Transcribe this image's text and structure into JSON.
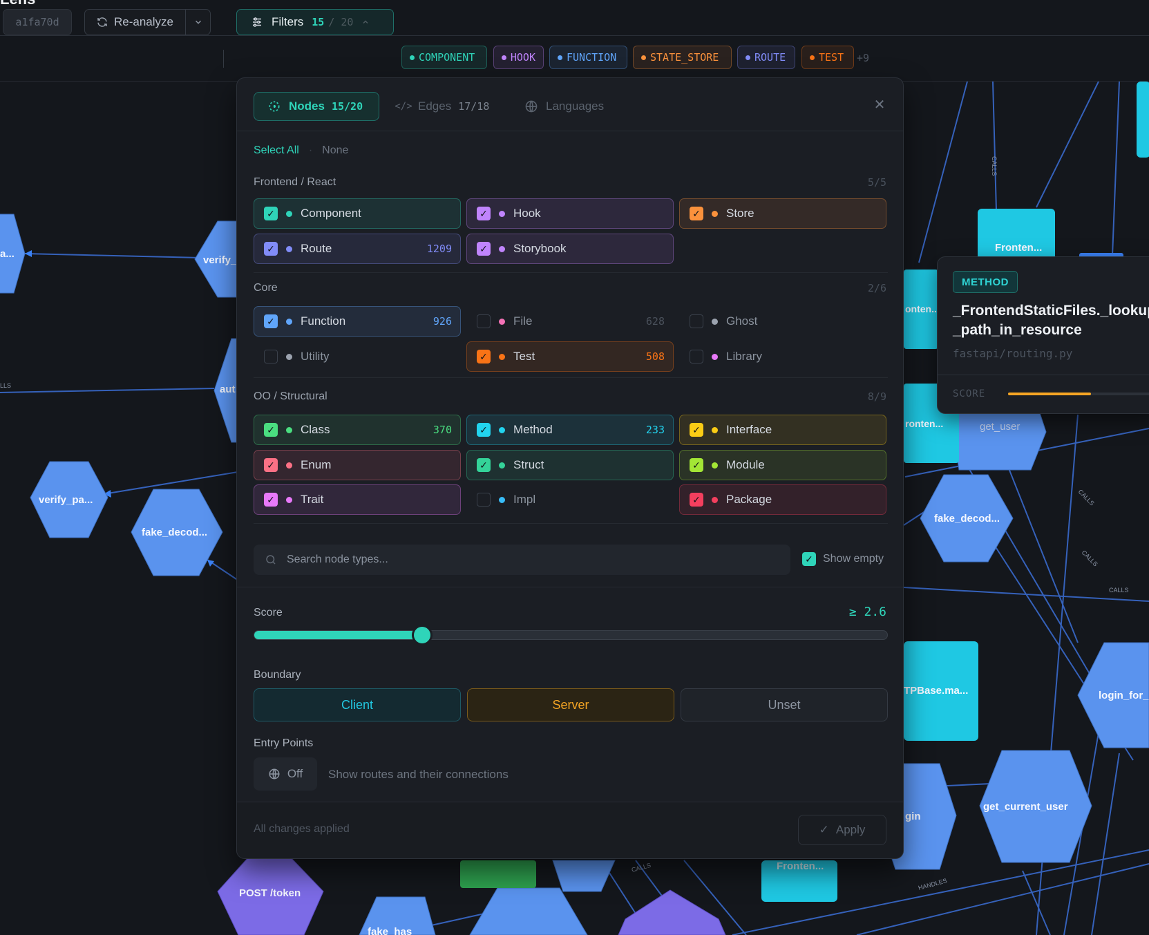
{
  "app": {
    "title": "Lens"
  },
  "toolbar": {
    "commit": "a1fa70d",
    "reanalyze_label": "Re-analyze",
    "filters_label": "Filters",
    "filters_active": "15",
    "filters_total": "/ 20",
    "chips": [
      {
        "label": "COMPONENT",
        "color": "#2fd4b9"
      },
      {
        "label": "HOOK",
        "color": "#c084fc"
      },
      {
        "label": "FUNCTION",
        "color": "#60a5fa"
      },
      {
        "label": "STATE_STORE",
        "color": "#fb923c"
      },
      {
        "label": "ROUTE",
        "color": "#818cf8"
      },
      {
        "label": "TEST",
        "color": "#f97316"
      }
    ],
    "chips_more": "+9"
  },
  "panel": {
    "tabs": {
      "nodes": {
        "label": "Nodes",
        "count": "15/20"
      },
      "edges": {
        "label": "Edges",
        "count": "17/18"
      },
      "languages": {
        "label": "Languages"
      }
    },
    "select_all": "Select All",
    "select_none": "None",
    "sections": [
      {
        "label": "Frontend / React",
        "count": "5/5"
      },
      {
        "label": "Core",
        "count": "2/6"
      },
      {
        "label": "OO / Structural",
        "count": "8/9"
      }
    ],
    "options": {
      "component": {
        "label": "Component",
        "count": "",
        "checked": true,
        "color": "#2fd4b9"
      },
      "hook": {
        "label": "Hook",
        "count": "",
        "checked": true,
        "color": "#c084fc"
      },
      "store": {
        "label": "Store",
        "count": "",
        "checked": true,
        "color": "#fb923c"
      },
      "route": {
        "label": "Route",
        "count": "1209",
        "checked": true,
        "color": "#818cf8"
      },
      "storybook": {
        "label": "Storybook",
        "count": "",
        "checked": true,
        "color": "#c084fc"
      },
      "function": {
        "label": "Function",
        "count": "926",
        "checked": true,
        "color": "#60a5fa"
      },
      "file": {
        "label": "File",
        "count": "628",
        "checked": false,
        "color": "#f472b6"
      },
      "ghost": {
        "label": "Ghost",
        "count": "",
        "checked": false,
        "color": "#9ca3af"
      },
      "utility": {
        "label": "Utility",
        "count": "",
        "checked": false,
        "color": "#9ca3af"
      },
      "test": {
        "label": "Test",
        "count": "508",
        "checked": true,
        "color": "#f97316"
      },
      "library": {
        "label": "Library",
        "count": "",
        "checked": false,
        "color": "#e879f9"
      },
      "class": {
        "label": "Class",
        "count": "370",
        "checked": true,
        "color": "#4ade80"
      },
      "method": {
        "label": "Method",
        "count": "233",
        "checked": true,
        "color": "#22d3ee"
      },
      "interface": {
        "label": "Interface",
        "count": "",
        "checked": true,
        "color": "#facc15"
      },
      "enum": {
        "label": "Enum",
        "count": "",
        "checked": true,
        "color": "#fb7185"
      },
      "struct": {
        "label": "Struct",
        "count": "",
        "checked": true,
        "color": "#34d399"
      },
      "module": {
        "label": "Module",
        "count": "",
        "checked": true,
        "color": "#a3e635"
      },
      "trait": {
        "label": "Trait",
        "count": "",
        "checked": true,
        "color": "#e879f9"
      },
      "impl": {
        "label": "Impl",
        "count": "",
        "checked": false,
        "color": "#38bdf8"
      },
      "package": {
        "label": "Package",
        "count": "",
        "checked": true,
        "color": "#f43f5e"
      }
    },
    "search_placeholder": "Search node types...",
    "show_empty": "Show empty",
    "score_label": "Score",
    "score_value": "≥ 2.6",
    "score_fraction": 0.265,
    "boundary_label": "Boundary",
    "boundary": {
      "client": "Client",
      "server": "Server",
      "unset": "Unset"
    },
    "entry_label": "Entry Points",
    "entry_toggle": "Off",
    "entry_desc": "Show routes and their connections",
    "footer_status": "All changes applied",
    "apply": "Apply"
  },
  "detail": {
    "badge": "METHOD",
    "name": "_FrontendStaticFiles._lookup_path_in_resource",
    "file": "fastapi/routing.py",
    "score_label": "SCORE",
    "score_fraction": 0.5
  },
  "graph_labels": {
    "n1": "a...",
    "n2": "verify_",
    "n3": "aut",
    "n4": "verify_pa...",
    "n5": "fake_decod...",
    "n6": "POST /token",
    "n7": "fake_has",
    "n8": "Fronten...",
    "n9": "onten...",
    "n10": "ronten...",
    "n11": "get_user",
    "n12": "fake_decod...",
    "n13": "TPBase.ma...",
    "n14": "login_for_",
    "n15": "gin",
    "n16": "get_current_user",
    "n17": "Fronten...",
    "e_calls": "CALLS",
    "e_handles": "HANDLES",
    "e_lls": "LLS"
  }
}
